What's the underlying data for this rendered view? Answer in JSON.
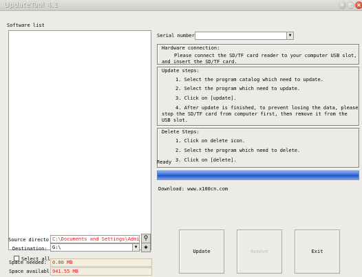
{
  "window": {
    "title": "UpdateTool 4.1",
    "min_glyph": "–",
    "max_glyph": "□",
    "close_glyph": "×"
  },
  "left": {
    "software_list_label": "Software list",
    "select_all_label": "Select all",
    "source_label": "Source directo",
    "source_value": "C:\\Documents and Settings\\Admin",
    "destination_label": "Destination:",
    "destination_value": "G:\\",
    "space_needed_label": "Space needed:",
    "space_needed_value": "0.00 MB",
    "space_available_label": "Space availabl",
    "space_available_value": "941.55 MB"
  },
  "right": {
    "serial_label": "Serial number:",
    "serial_value": "",
    "hardware": {
      "title": "Hardware connection:",
      "lines": [
        "Please connect the SD/TF card reader to your computer USB slot,",
        "and insert the SD/TF card."
      ]
    },
    "update_steps": {
      "title": "Update steps:",
      "lines": [
        "1. Select the program catalog which need to update.",
        "2. Select the program which need to update.",
        "3. Click on [update].",
        "4. After update is finished, to prevent losing the data, please",
        "stop the SD/TF card from computer first, then remove it from the",
        "USB slot."
      ]
    },
    "delete_steps": {
      "title": "Delete Steps:",
      "lines": [
        "1. Click on delete icon.",
        "2. Select the program which need to delete.",
        "3. Click on [delete]."
      ]
    },
    "status": "Ready",
    "progress": 1.0,
    "download_text": "Download: www.x100cn.com"
  },
  "buttons": {
    "update": "Update",
    "remove": "Remove",
    "exit": "Exit"
  },
  "icons": {
    "browse": "binoculars-icon",
    "destination": "drive-icon"
  },
  "colors": {
    "progress": "#2f63d4",
    "path_text": "#e0161a",
    "info_bg": "#f3eedd"
  }
}
